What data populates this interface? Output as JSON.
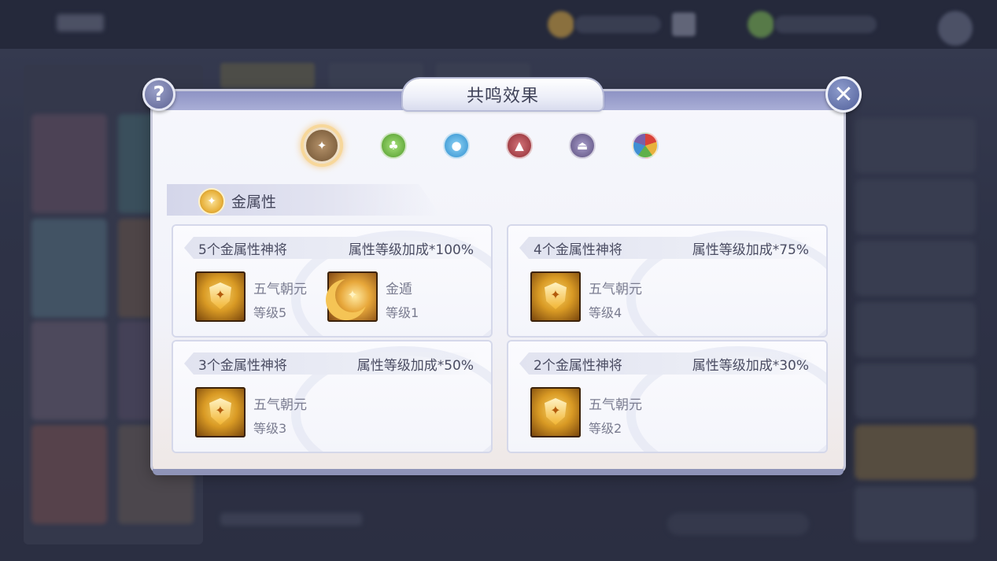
{
  "dialog": {
    "title": "共鸣效果",
    "help_symbol": "?",
    "close_symbol": "✕"
  },
  "elements": [
    {
      "name": "metal",
      "color": "#8a6a48",
      "selected": true
    },
    {
      "name": "wood",
      "color": "#6fbf3e",
      "selected": false
    },
    {
      "name": "water",
      "color": "#3fa7e0",
      "selected": false
    },
    {
      "name": "fire",
      "color": "#b8434a",
      "selected": false
    },
    {
      "name": "earth",
      "color": "#7b6e9e",
      "selected": false
    },
    {
      "name": "all",
      "color": "#c9503a",
      "selected": false
    }
  ],
  "section": {
    "title": "金属性"
  },
  "tiers": [
    {
      "count_label": "5个金属性神将",
      "bonus_label": "属性等级加成*100%",
      "skills": [
        {
          "name": "五气朝元",
          "level": "等级5",
          "icon": "shield-icon"
        },
        {
          "name": "金遁",
          "level": "等级1",
          "icon": "moon-icon"
        }
      ]
    },
    {
      "count_label": "4个金属性神将",
      "bonus_label": "属性等级加成*75%",
      "skills": [
        {
          "name": "五气朝元",
          "level": "等级4",
          "icon": "shield-icon"
        }
      ]
    },
    {
      "count_label": "3个金属性神将",
      "bonus_label": "属性等级加成*50%",
      "skills": [
        {
          "name": "五气朝元",
          "level": "等级3",
          "icon": "shield-icon"
        }
      ]
    },
    {
      "count_label": "2个金属性神将",
      "bonus_label": "属性等级加成*30%",
      "skills": [
        {
          "name": "五气朝元",
          "level": "等级2",
          "icon": "shield-icon"
        }
      ]
    }
  ]
}
